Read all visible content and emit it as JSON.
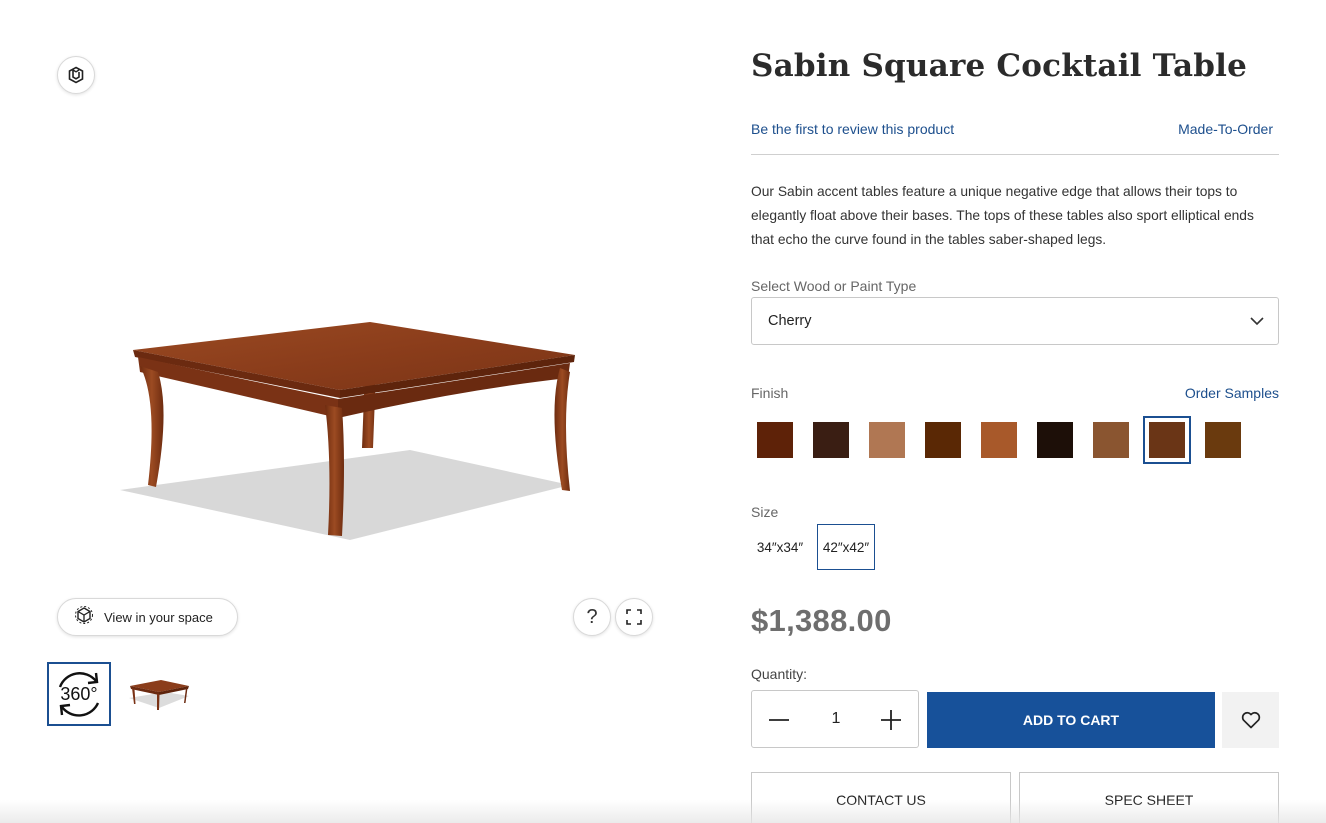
{
  "product": {
    "title": "Sabin Square Cocktail Table",
    "review_link": "Be the first to review this product",
    "badge": "Made-To-Order",
    "description": "Our Sabin accent tables feature a unique negative edge that allows their tops to elegantly float above their bases. The tops of these tables also sport elliptical ends that echo the curve found in the tables saber-shaped legs."
  },
  "viewer": {
    "view_in_space_label": "View in your space",
    "help_glyph": "?",
    "thumb_360_label": "360°"
  },
  "wood": {
    "label": "Select Wood or Paint Type",
    "selected": "Cherry"
  },
  "finish": {
    "label": "Finish",
    "order_samples": "Order Samples",
    "swatches": [
      "#5e2208",
      "#3a1e13",
      "#b07753",
      "#5a2805",
      "#a8592a",
      "#1d0f08",
      "#8a5530",
      "#6a3516",
      "#6a3a0e"
    ],
    "selected_index": 7
  },
  "size": {
    "label": "Size",
    "options": [
      "34″x34″",
      "42″x42″"
    ],
    "selected_index": 1
  },
  "price": "$1,388.00",
  "quantity": {
    "label": "Quantity:",
    "value": "1"
  },
  "actions": {
    "add_to_cart": "ADD TO CART",
    "contact_us": "CONTACT US",
    "spec_sheet": "SPEC SHEET"
  },
  "colors": {
    "accent": "#17519a",
    "link": "#1d4f8d",
    "wood": "#8b3f1d"
  }
}
